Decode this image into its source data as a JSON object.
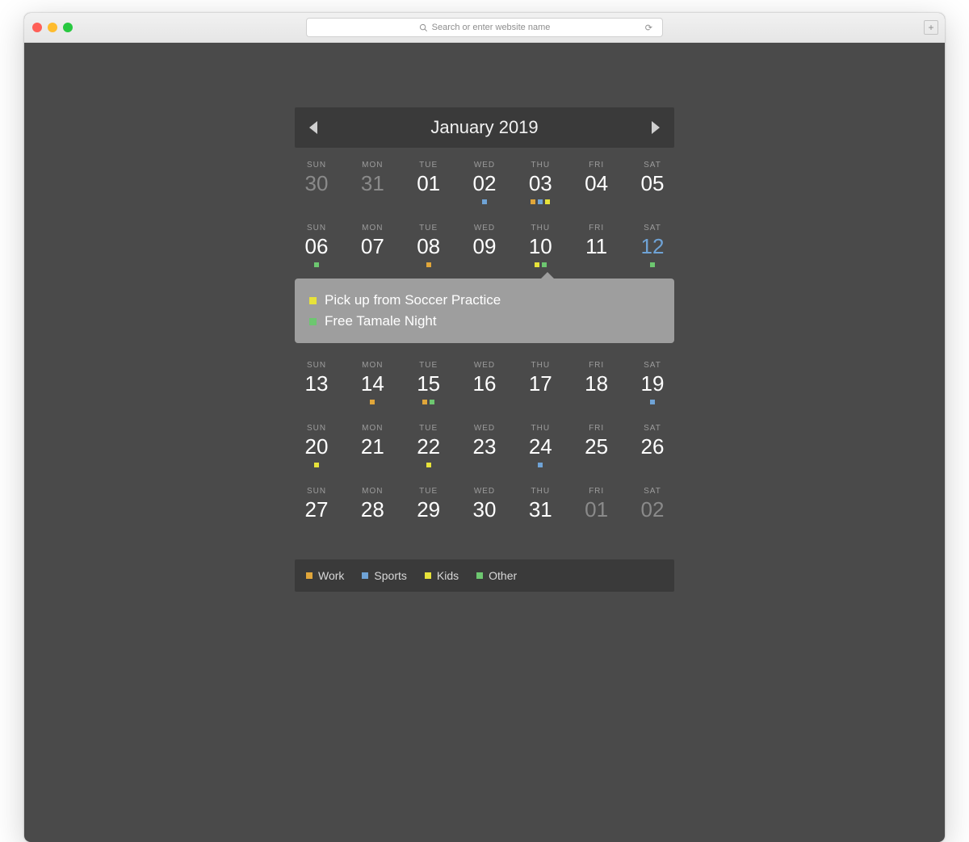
{
  "browser": {
    "search_placeholder": "Search or enter website name"
  },
  "calendar": {
    "title": "January 2019",
    "day_headers": [
      "SUN",
      "MON",
      "TUE",
      "WED",
      "THU",
      "FRI",
      "SAT"
    ],
    "weeks": [
      [
        {
          "n": "30",
          "adj": true
        },
        {
          "n": "31",
          "adj": true
        },
        {
          "n": "01"
        },
        {
          "n": "02",
          "markers": [
            "sports"
          ]
        },
        {
          "n": "03",
          "markers": [
            "work",
            "sports",
            "kids"
          ]
        },
        {
          "n": "04"
        },
        {
          "n": "05"
        }
      ],
      [
        {
          "n": "06",
          "markers": [
            "other"
          ]
        },
        {
          "n": "07"
        },
        {
          "n": "08",
          "markers": [
            "work"
          ]
        },
        {
          "n": "09"
        },
        {
          "n": "10",
          "markers": [
            "kids",
            "other"
          ],
          "selected": true
        },
        {
          "n": "11"
        },
        {
          "n": "12",
          "today": true,
          "markers": [
            "other"
          ]
        }
      ],
      [
        {
          "n": "13"
        },
        {
          "n": "14",
          "markers": [
            "work"
          ]
        },
        {
          "n": "15",
          "markers": [
            "work",
            "other"
          ]
        },
        {
          "n": "16"
        },
        {
          "n": "17"
        },
        {
          "n": "18"
        },
        {
          "n": "19",
          "markers": [
            "sports"
          ]
        }
      ],
      [
        {
          "n": "20",
          "markers": [
            "kids"
          ]
        },
        {
          "n": "21"
        },
        {
          "n": "22",
          "markers": [
            "kids"
          ]
        },
        {
          "n": "23"
        },
        {
          "n": "24",
          "markers": [
            "sports"
          ]
        },
        {
          "n": "25"
        },
        {
          "n": "26"
        }
      ],
      [
        {
          "n": "27"
        },
        {
          "n": "28"
        },
        {
          "n": "29"
        },
        {
          "n": "30"
        },
        {
          "n": "31"
        },
        {
          "n": "01",
          "adj": true
        },
        {
          "n": "02",
          "adj": true
        }
      ]
    ],
    "popover_after_week": 1,
    "events": [
      {
        "color": "kids",
        "text": "Pick up from Soccer Practice"
      },
      {
        "color": "other",
        "text": "Free Tamale Night"
      }
    ],
    "legend": [
      {
        "color": "work",
        "label": "Work"
      },
      {
        "color": "sports",
        "label": "Sports"
      },
      {
        "color": "kids",
        "label": "Kids"
      },
      {
        "color": "other",
        "label": "Other"
      }
    ]
  }
}
